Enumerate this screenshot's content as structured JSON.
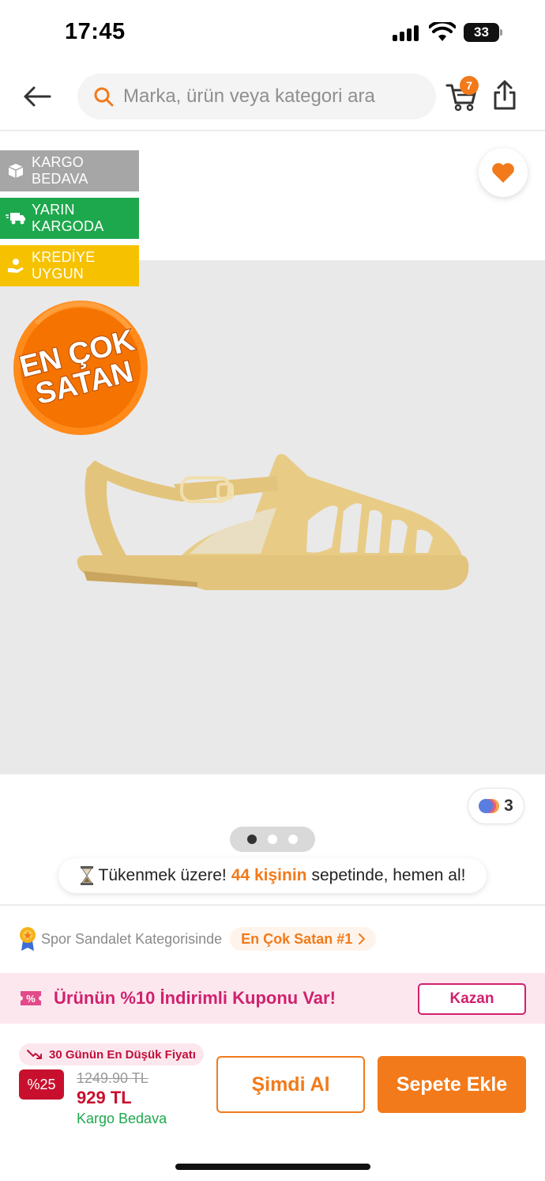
{
  "status_bar": {
    "time": "17:45",
    "battery": "33"
  },
  "header": {
    "search_placeholder": "Marka, ürün veya kategori ara",
    "cart_count": "7"
  },
  "badges": [
    {
      "line1": "KARGO",
      "line2": "BEDAVA",
      "color": "#a6a6a6",
      "icon": "box-icon"
    },
    {
      "line1": "YARIN",
      "line2": "KARGODA",
      "color": "#1ea84d",
      "icon": "truck-icon"
    },
    {
      "line1": "KREDİYE",
      "line2": "UYGUN",
      "color": "#f6c200",
      "icon": "credit-hand-icon"
    }
  ],
  "best_seller": {
    "line1": "EN ÇOK",
    "line2": "SATAN"
  },
  "colors": {
    "count": "3"
  },
  "gallery": {
    "dots": 3,
    "active": 0
  },
  "stock": {
    "prefix": "Tükenmek üzere!",
    "highlight": "44 kişinin",
    "suffix": "sepetinde, hemen al!"
  },
  "category": {
    "text": "Spor Sandalet Kategorisinde",
    "link": "En Çok Satan #1"
  },
  "coupon": {
    "text": "Ürünün %10 İndirimli Kuponu Var!",
    "button": "Kazan"
  },
  "pricing": {
    "low_price_label": "30 Günün En Düşük Fiyatı",
    "discount": "%25",
    "old_price": "1249.90 TL",
    "new_price": "929 TL",
    "shipping": "Kargo Bedava"
  },
  "actions": {
    "buy_now": "Şimdi Al",
    "add_to_cart": "Sepete Ekle"
  },
  "theme": {
    "accent": "#f27a1a",
    "sale": "#c8102e",
    "pink": "#d0216d",
    "green": "#1ea84d"
  }
}
